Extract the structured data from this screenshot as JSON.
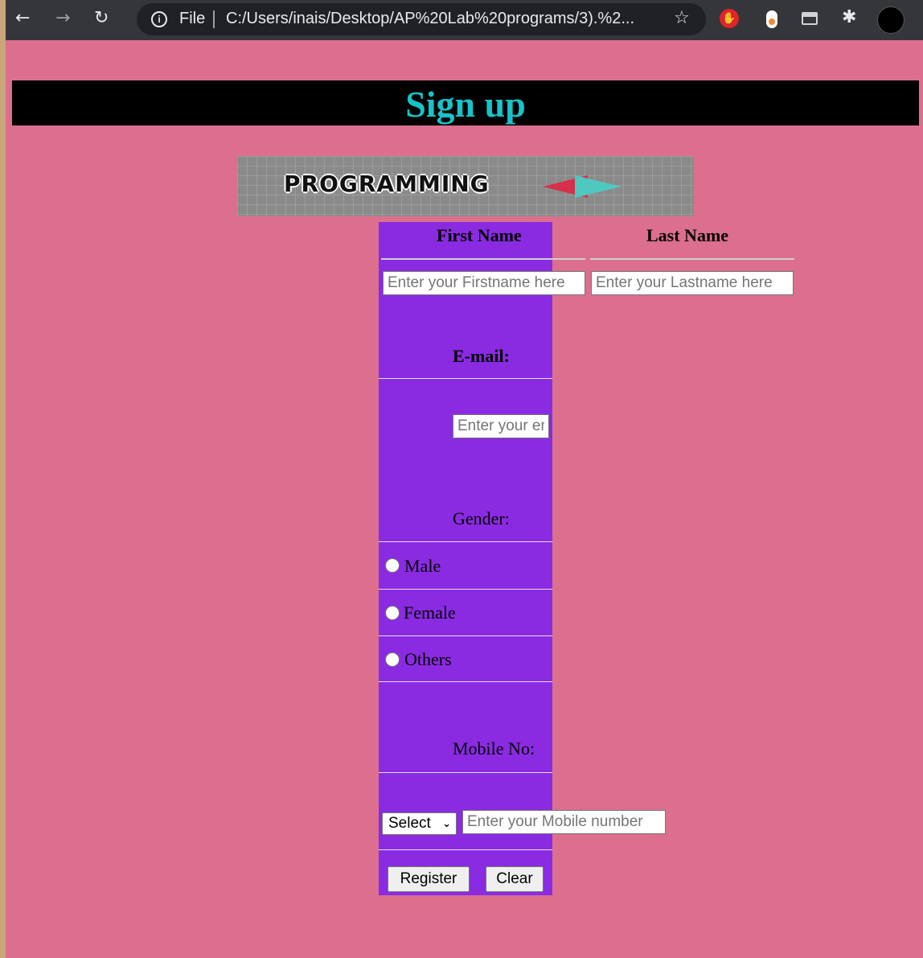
{
  "browser": {
    "file_label": "File",
    "url": "C:/Users/inais/Desktop/AP%20Lab%20programs/3).%2...",
    "icons": [
      "back-arrow-icon",
      "forward-arrow-icon",
      "reload-icon",
      "info-icon",
      "star-icon",
      "adblock-stop-icon",
      "ext-drop-icon",
      "ext-window-icon",
      "puzzle-icon",
      "profile-avatar"
    ]
  },
  "header": {
    "title": "Sign up",
    "title_color": "#17c3c9",
    "bar_color": "#000000"
  },
  "banner": {
    "text": "PROGRAMMING"
  },
  "form": {
    "column_color": "#8a2be2",
    "page_color": "#dc6f8e",
    "first_name_label": "First Name",
    "last_name_label": "Last Name",
    "first_name_placeholder": "Enter your Firstname here",
    "last_name_placeholder": "Enter your Lastname here",
    "email_label": "E-mail:",
    "email_placeholder": "Enter your email",
    "gender_label": "Gender:",
    "gender_options": [
      "Male",
      "Female",
      "Others"
    ],
    "mobile_label": "Mobile No:",
    "country_code_select": "Select",
    "mobile_placeholder": "Enter your Mobile number",
    "register_label": "Register",
    "clear_label": "Clear"
  }
}
